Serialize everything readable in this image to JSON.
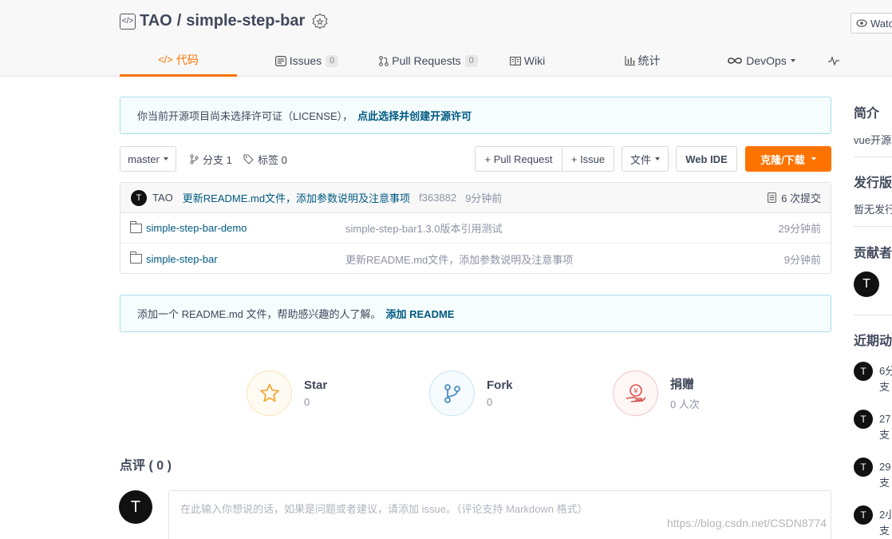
{
  "repo": {
    "owner": "TAO",
    "separator": "/",
    "name": "simple-step-bar",
    "watch_label": "Watc"
  },
  "tabs": [
    {
      "label": "代码",
      "count": null
    },
    {
      "label": "Issues",
      "count": "0"
    },
    {
      "label": "Pull Requests",
      "count": "0"
    },
    {
      "label": "Wiki",
      "count": null
    },
    {
      "label": "统计",
      "count": null
    },
    {
      "label": "DevOps",
      "count": null
    }
  ],
  "license_notice": {
    "text": "你当前开源项目尚未选择许可证（LICENSE），",
    "link": "点此选择并创建开源许可"
  },
  "toolbar": {
    "branch": "master",
    "branches_label": "分支 1",
    "tags_label": "标签 0",
    "pull_request": "+ Pull Request",
    "issue": "+ Issue",
    "files": "文件",
    "web_ide": "Web IDE",
    "clone": "克隆/下载"
  },
  "latest_commit": {
    "avatar": "T",
    "author": "TAO",
    "message": "更新README.md文件，添加参数说明及注意事项",
    "hash": "f363882",
    "time": "9分钟前",
    "commits": "6 次提交"
  },
  "files": [
    {
      "name": "simple-step-bar-demo",
      "message": "simple-step-bar1.3.0版本引用测试",
      "time": "29分钟前"
    },
    {
      "name": "simple-step-bar",
      "message": "更新README.md文件，添加参数说明及注意事项",
      "time": "9分钟前"
    }
  ],
  "readme_notice": {
    "text": "添加一个 README.md 文件，帮助感兴趣的人了解。",
    "link": "添加 README"
  },
  "stats": {
    "star_label": "Star",
    "star_value": "0",
    "fork_label": "Fork",
    "fork_value": "0",
    "donate_label": "捐赠",
    "donate_value": "0 人次"
  },
  "comments": {
    "title": "点评 ( 0 )",
    "avatar": "T",
    "placeholder": "在此输入你想说的话，如果是问题或者建议，请添加 issue。（评论支持 Markdown 格式）"
  },
  "sidebar": {
    "intro_title": "简介",
    "intro_text": "vue开源",
    "release_title": "发行版",
    "release_text": "暂无发行",
    "contributors_title": "贡献者",
    "contributor_avatar": "T",
    "activity_title": "近期动",
    "activities": [
      {
        "line1": "6分",
        "line2": "支"
      },
      {
        "line1": "27",
        "line2": "支"
      },
      {
        "line1": "29",
        "line2": "支"
      },
      {
        "line1": "2小",
        "line2": "支"
      }
    ]
  },
  "watermark": "https://blog.csdn.net/CSDN8774"
}
